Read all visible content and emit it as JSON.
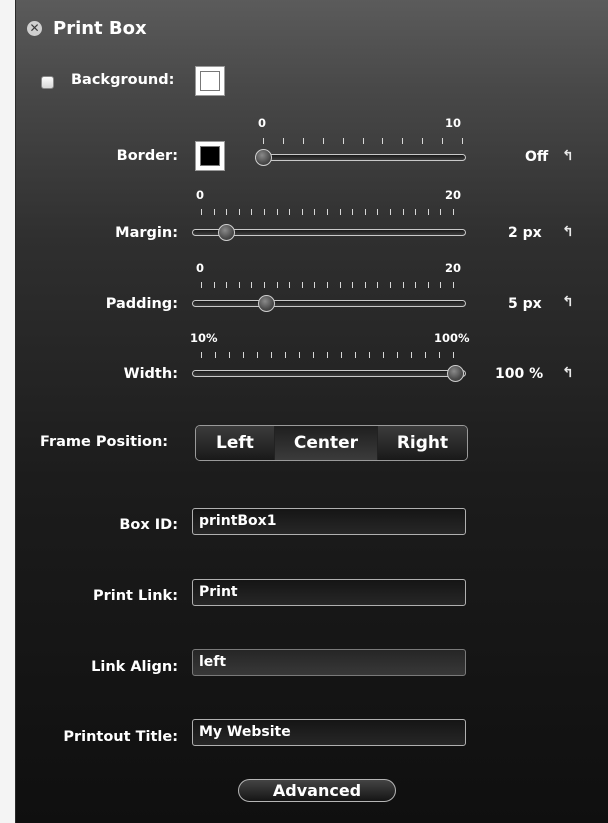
{
  "window": {
    "title": "Print Box"
  },
  "background": {
    "label": "Background:",
    "checked": false,
    "color": "#ffffff"
  },
  "border": {
    "label": "Border:",
    "color": "#000000",
    "min": "0",
    "max": "10",
    "value": 0,
    "value_text": "Off"
  },
  "margin": {
    "label": "Margin:",
    "min": "0",
    "max": "20",
    "value": 2,
    "value_text": "2 px"
  },
  "padding": {
    "label": "Padding:",
    "min": "0",
    "max": "20",
    "value": 5,
    "value_text": "5 px"
  },
  "width": {
    "label": "Width:",
    "min": "10%",
    "max": "100%",
    "value": 100,
    "value_text": "100 %"
  },
  "frame_position": {
    "label": "Frame Position:",
    "options": [
      "Left",
      "Center",
      "Right"
    ],
    "selected": "Center"
  },
  "box_id": {
    "label": "Box ID:",
    "value": "printBox1"
  },
  "print_link": {
    "label": "Print Link:",
    "value": "Print"
  },
  "link_align": {
    "label": "Link Align:",
    "value": "left"
  },
  "printout_title": {
    "label": "Printout Title:",
    "value": "My Website"
  },
  "advanced_button": {
    "label": "Advanced"
  },
  "icons": {
    "close": "close-icon",
    "reset": "reset-arrow-icon"
  },
  "colors": {
    "panel_top": "#5b5b5b",
    "panel_bottom": "#0f0f0f"
  }
}
